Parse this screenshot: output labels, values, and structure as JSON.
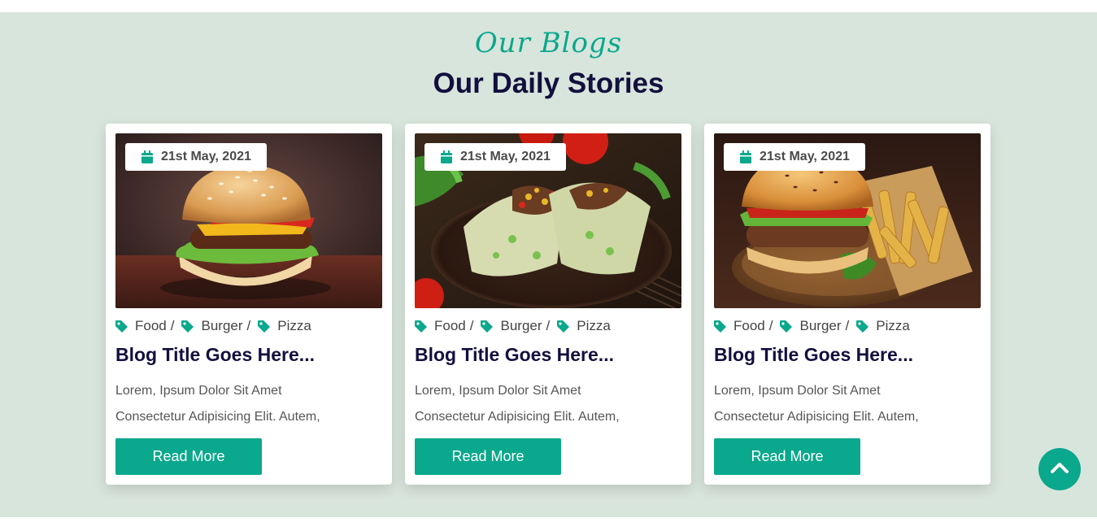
{
  "section": {
    "subheading": "Our Blogs",
    "heading": "Our Daily Stories",
    "background": "#d8e5dc",
    "accent": "#0aa88c"
  },
  "cards": [
    {
      "image": "burger-photo",
      "date": "21st May, 2021",
      "date_icon": "calendar-icon",
      "tags": [
        {
          "label": "Food",
          "sep": "/"
        },
        {
          "label": "Burger",
          "sep": "/"
        },
        {
          "label": "Pizza",
          "sep": ""
        }
      ],
      "title": "Blog Title Goes Here...",
      "text_line1": "Lorem, Ipsum Dolor Sit Amet",
      "text_line2": "Consectetur Adipisicing Elit. Autem,",
      "button": "Read More"
    },
    {
      "image": "burrito-wrap-photo",
      "date": "21st May, 2021",
      "date_icon": "calendar-icon",
      "tags": [
        {
          "label": "Food",
          "sep": "/"
        },
        {
          "label": "Burger",
          "sep": "/"
        },
        {
          "label": "Pizza",
          "sep": ""
        }
      ],
      "title": "Blog Title Goes Here...",
      "text_line1": "Lorem, Ipsum Dolor Sit Amet",
      "text_line2": "Consectetur Adipisicing Elit. Autem,",
      "button": "Read More"
    },
    {
      "image": "burger-and-fries-photo",
      "date": "21st May, 2021",
      "date_icon": "calendar-icon",
      "tags": [
        {
          "label": "Food",
          "sep": "/"
        },
        {
          "label": "Burger",
          "sep": "/"
        },
        {
          "label": "Pizza",
          "sep": ""
        }
      ],
      "title": "Blog Title Goes Here...",
      "text_line1": "Lorem, Ipsum Dolor Sit Amet",
      "text_line2": "Consectetur Adipisicing Elit. Autem,",
      "button": "Read More"
    }
  ],
  "scroll_top_icon": "chevron-up-icon"
}
